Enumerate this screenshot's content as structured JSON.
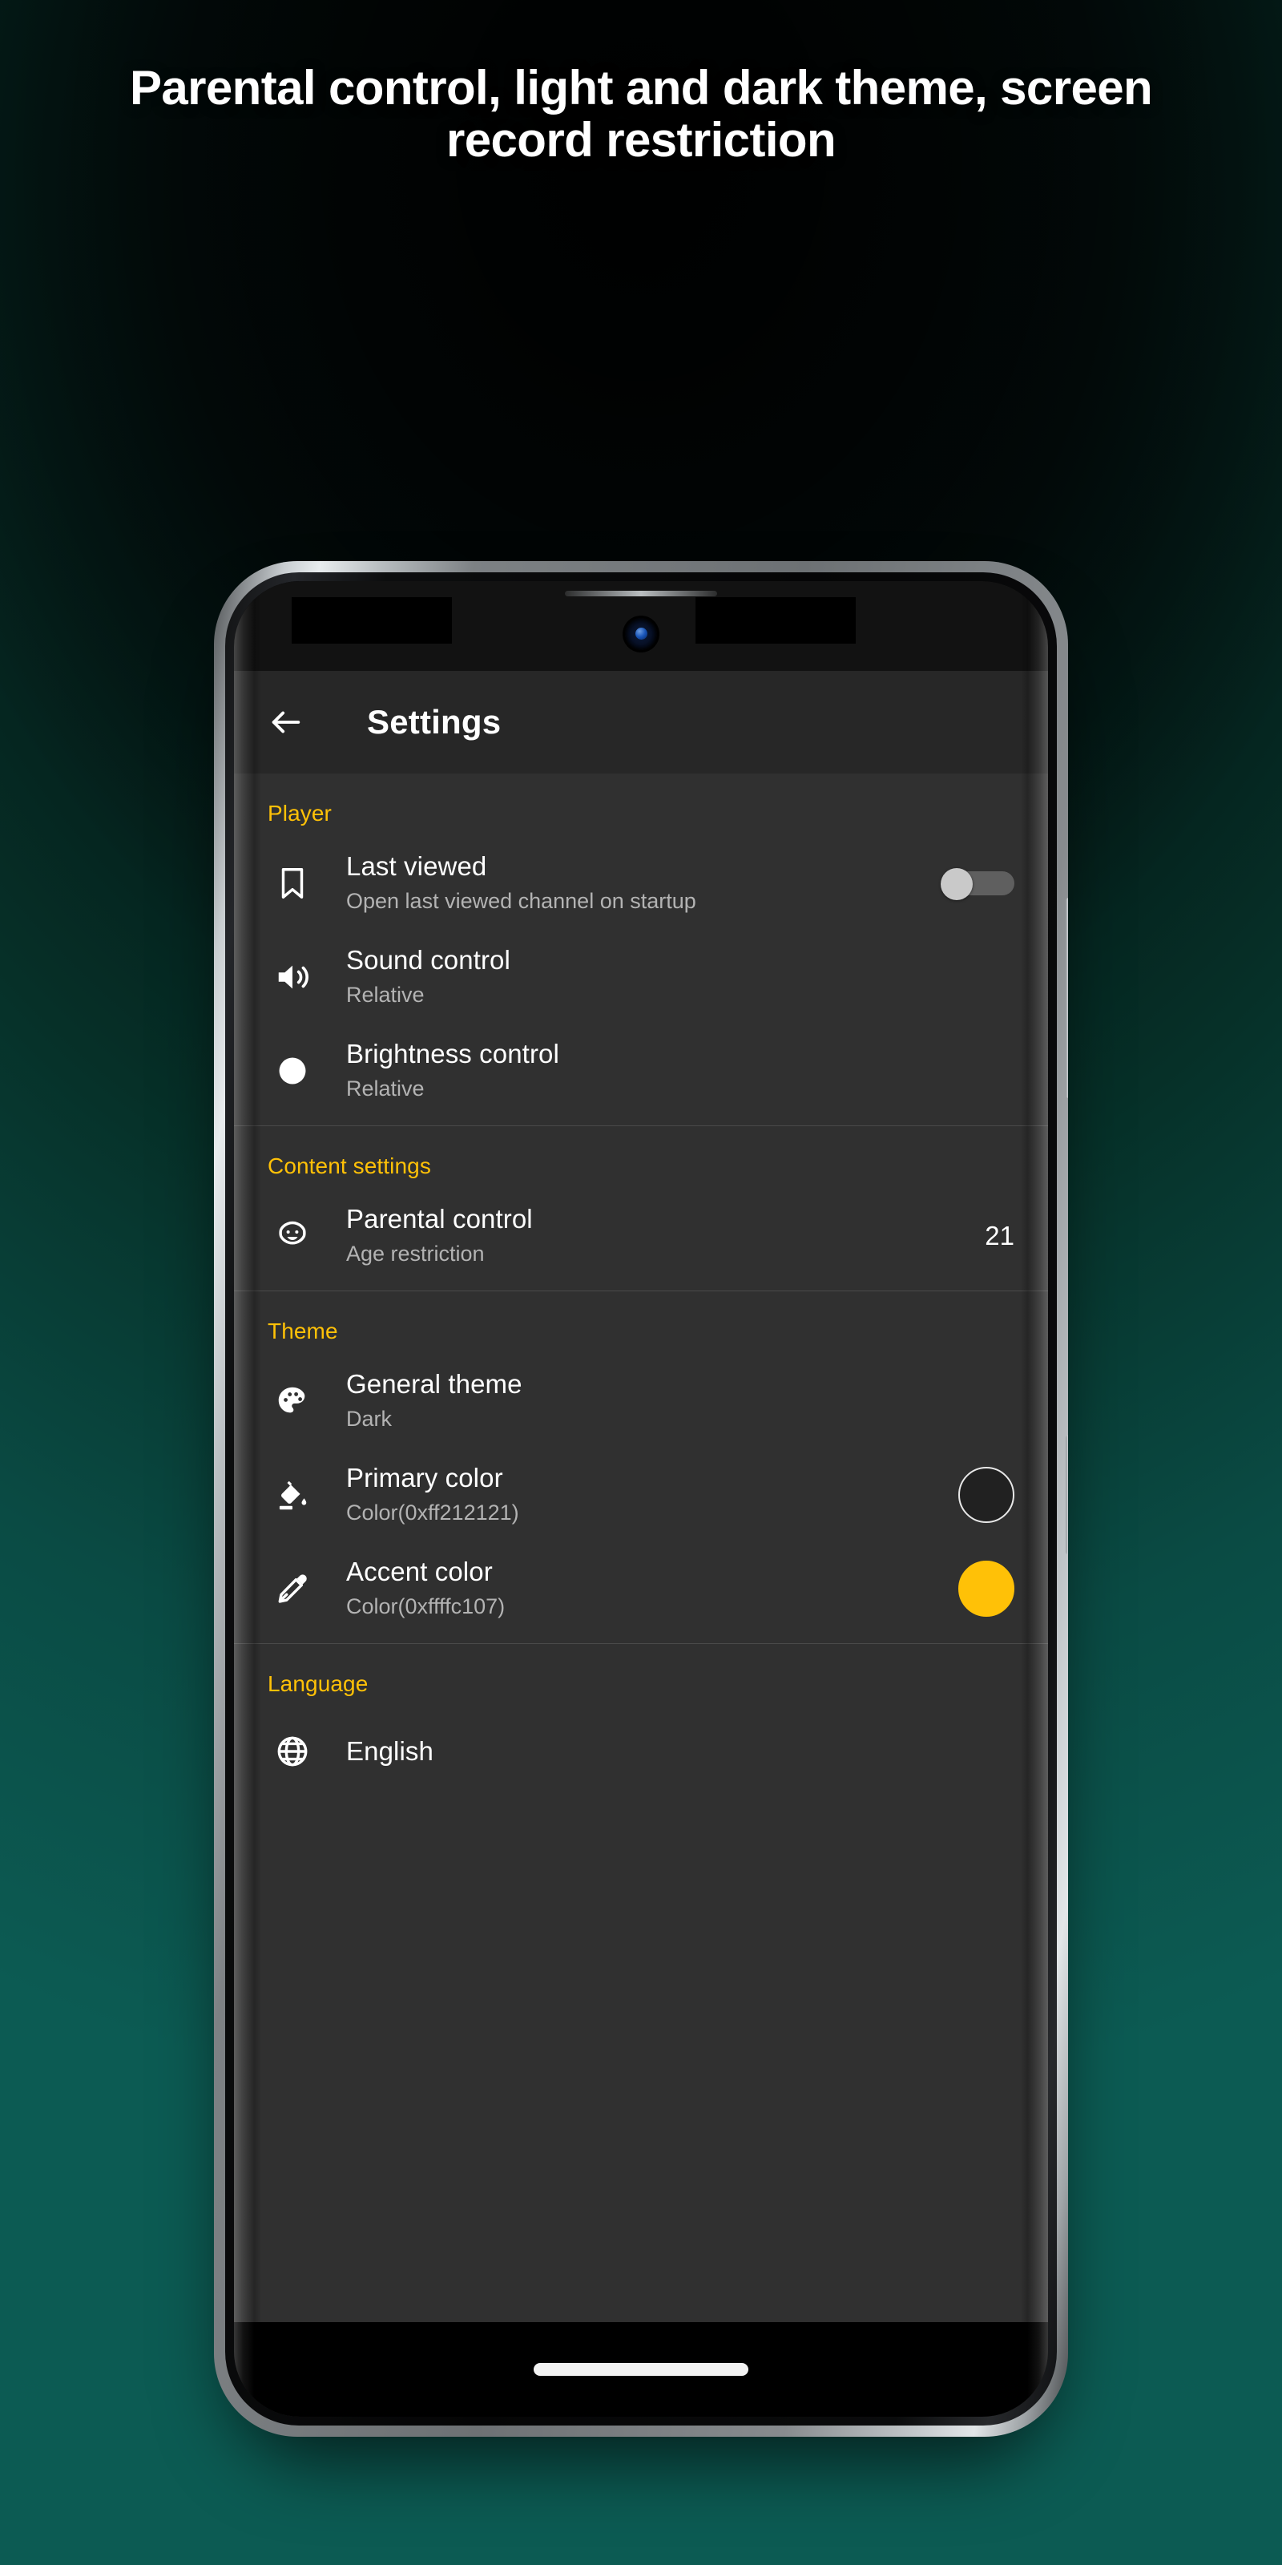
{
  "promo": {
    "headline": "Parental control, light and dark theme, screen record restriction",
    "background_top_color": "#020606",
    "background_bottom_color": "#0c5b53"
  },
  "device": {
    "frame_color": "#9fa4a7",
    "camera": "front-camera-punch-hole",
    "gesture_bar": "home-indicator"
  },
  "appbar": {
    "back_icon": "arrow-left-icon",
    "title": "Settings"
  },
  "theme_colors": {
    "accent": "#ffc107",
    "surface": "#303030",
    "appbar": "#272727",
    "primary_swatch": "#212121",
    "accent_swatch": "#ffc107",
    "title_text": "#ffffff",
    "subtitle_text": "#b3b3b3"
  },
  "sections": [
    {
      "label": "Player",
      "rows": [
        {
          "icon": "bookmark-icon",
          "title": "Last viewed",
          "subtitle": "Open last viewed channel on startup",
          "trail_type": "toggle",
          "toggle_state": "off"
        },
        {
          "icon": "volume-up-icon",
          "title": "Sound control",
          "subtitle": "Relative",
          "trail_type": "none"
        },
        {
          "icon": "brightness-circle-icon",
          "title": "Brightness control",
          "subtitle": "Relative",
          "trail_type": "none"
        }
      ]
    },
    {
      "label": "Content settings",
      "rows": [
        {
          "icon": "child-face-icon",
          "title": "Parental control",
          "subtitle": "Age restriction",
          "trail_type": "value",
          "value": "21"
        }
      ]
    },
    {
      "label": "Theme",
      "rows": [
        {
          "icon": "palette-icon",
          "title": "General theme",
          "subtitle": "Dark",
          "trail_type": "none"
        },
        {
          "icon": "paint-bucket-icon",
          "title": "Primary color",
          "subtitle": "Color(0xff212121)",
          "trail_type": "swatch",
          "swatch_color": "#212121"
        },
        {
          "icon": "eyedropper-icon",
          "title": "Accent color",
          "subtitle": "Color(0xffffc107)",
          "trail_type": "swatch",
          "swatch_color": "#ffc107"
        }
      ]
    },
    {
      "label": "Language",
      "rows": [
        {
          "icon": "globe-icon",
          "title": "English",
          "subtitle": "",
          "trail_type": "none"
        }
      ]
    }
  ]
}
